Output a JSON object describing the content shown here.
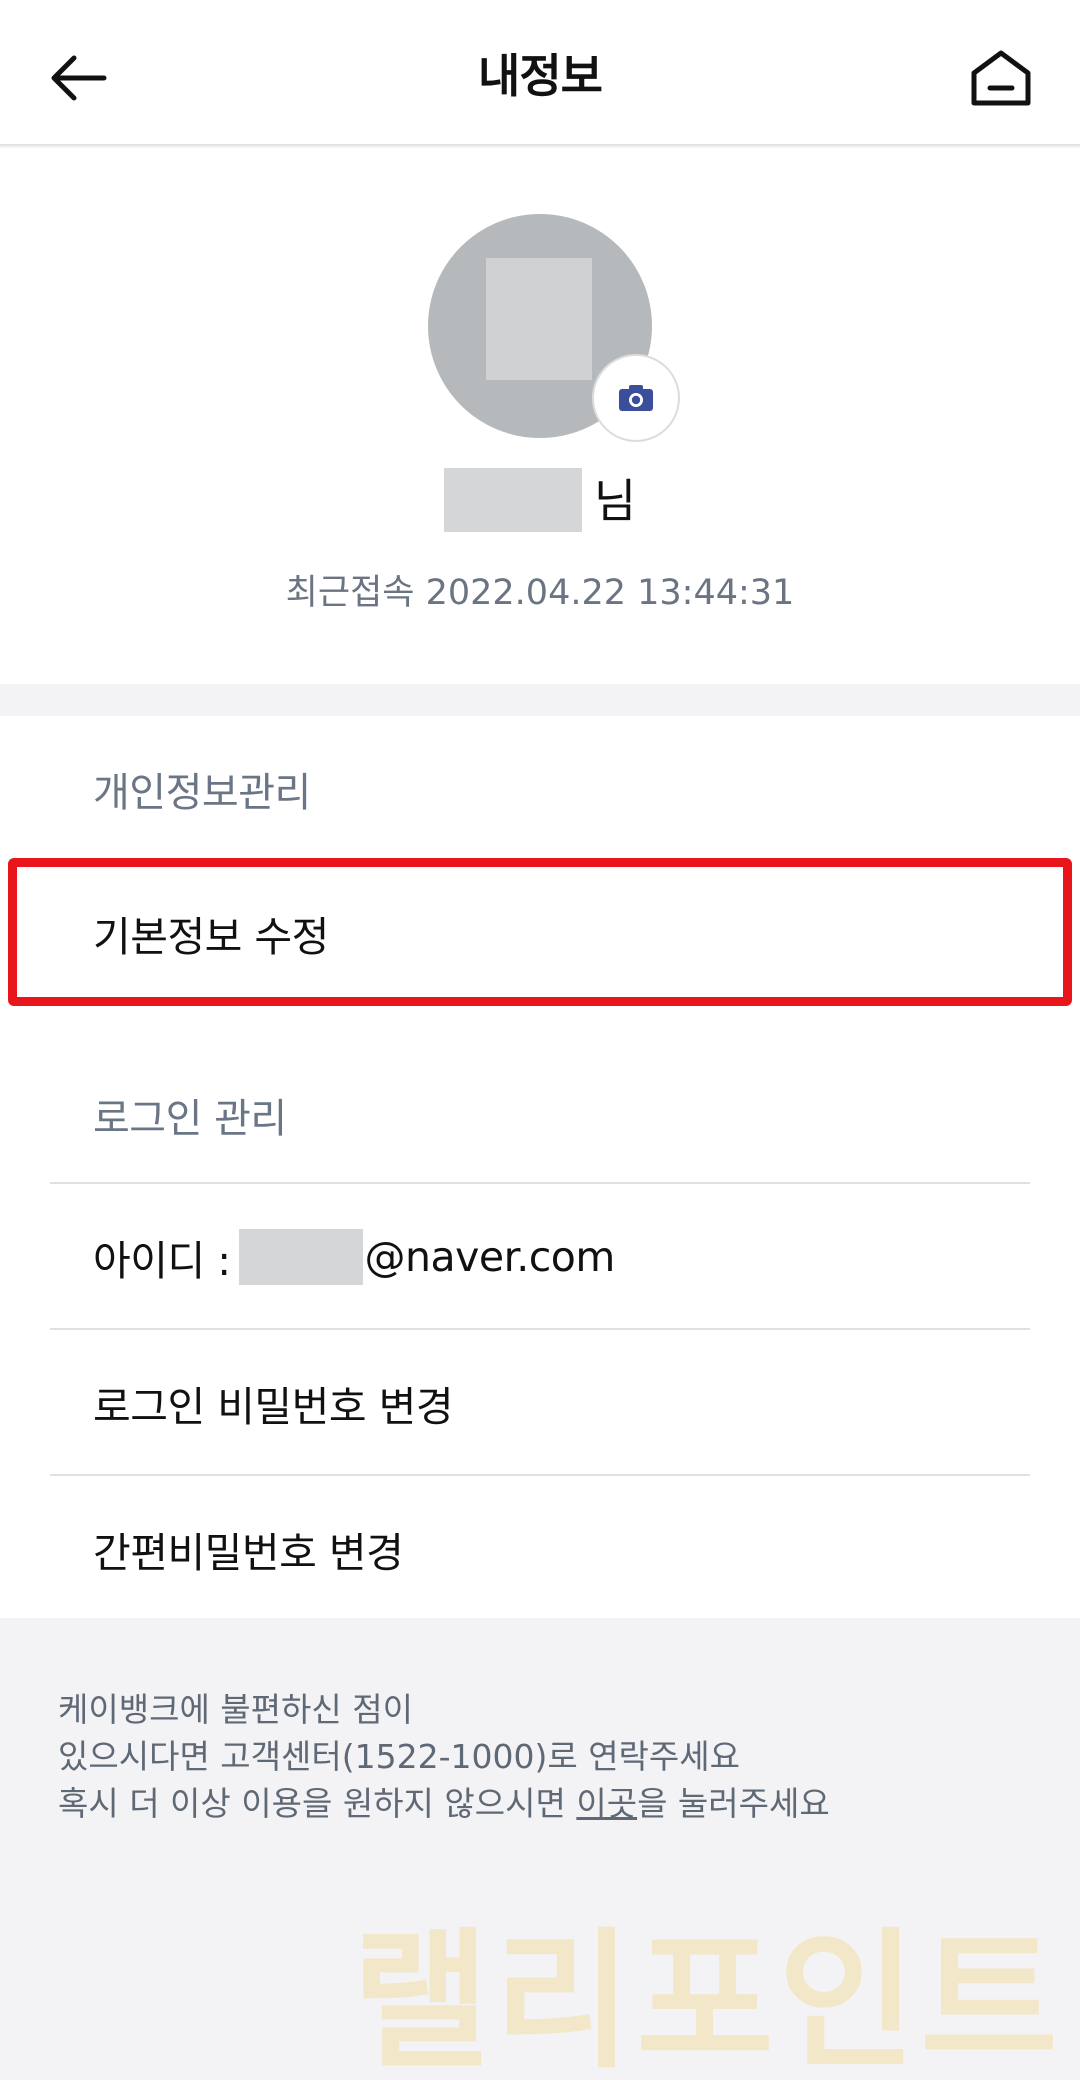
{
  "header": {
    "title": "내정보",
    "back_icon": "arrow-left-icon",
    "home_icon": "home-icon"
  },
  "profile": {
    "name_suffix": "님",
    "last_access": "최근접속 2022.04.22 13:44:31",
    "camera_icon": "camera-icon"
  },
  "personal": {
    "section_label": "개인정보관리",
    "items": [
      {
        "label": "기본정보 수정"
      }
    ]
  },
  "login": {
    "section_label": "로그인 관리",
    "id_prefix": "아이디 :",
    "id_domain": "@naver.com",
    "items": [
      {
        "label": "로그인 비밀번호 변경"
      },
      {
        "label": "간편비밀번호 변경"
      }
    ]
  },
  "footer": {
    "line1": "케이뱅크에 불편하신 점이",
    "line2": "있으시다면 고객센터(1522-1000)로 연락주세요",
    "line3_before": "혹시 더 이상 이용을 원하지 않으시면 ",
    "line3_link": "이곳",
    "line3_after": "을 눌러주세요"
  },
  "watermark": "랠리포인트",
  "colors": {
    "highlight": "#e8161b",
    "accent_camera": "#3b4e9b",
    "label_gray": "#6a7686"
  }
}
